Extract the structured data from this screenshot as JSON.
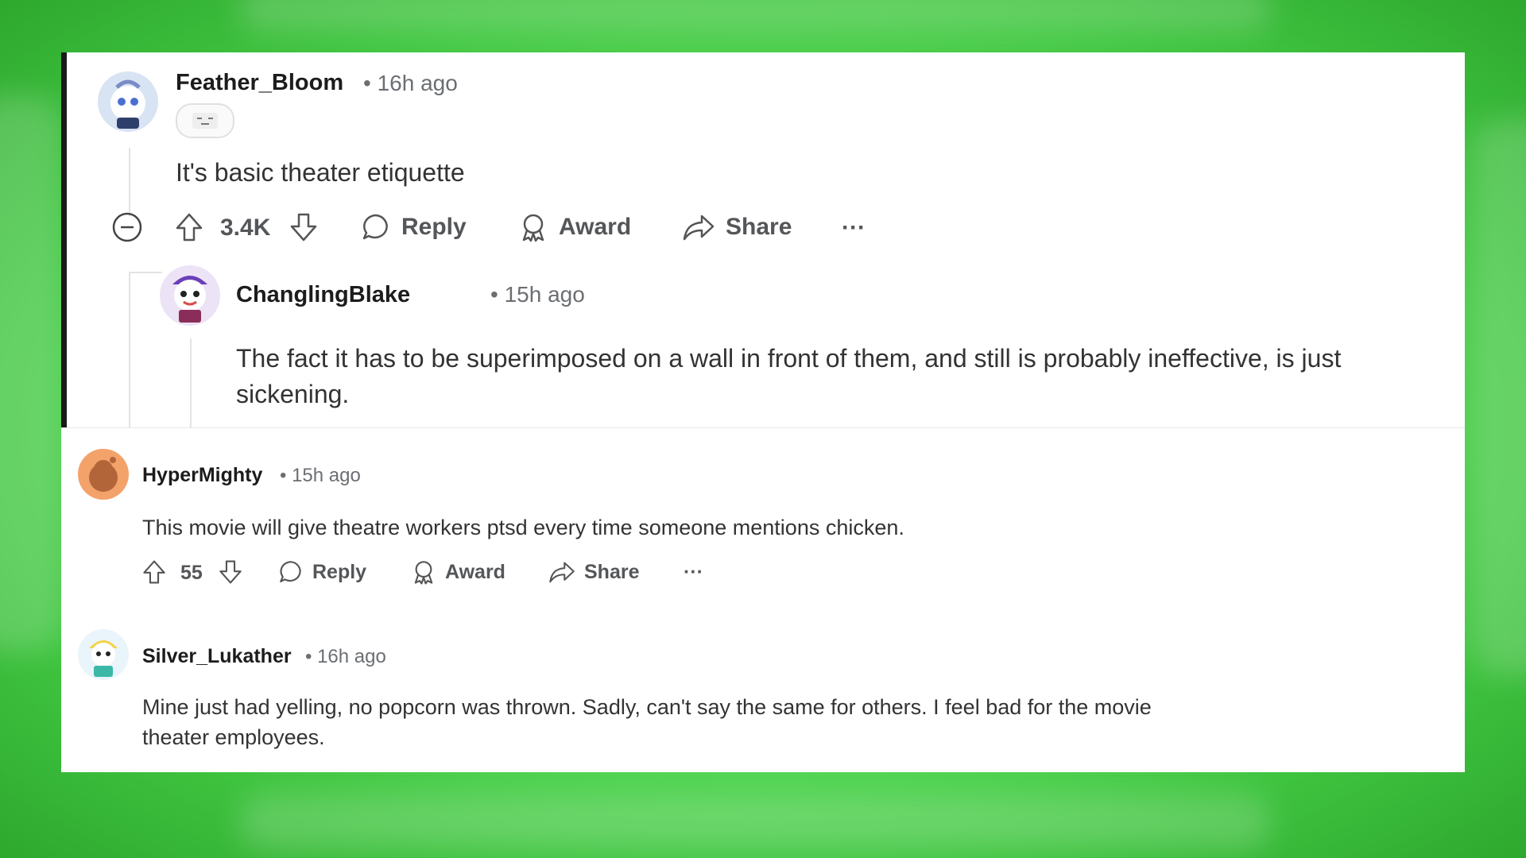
{
  "comments": [
    {
      "username": "Feather_Bloom",
      "time": "• 16h ago",
      "body": "It's basic theater etiquette",
      "score": "3.4K",
      "actions": {
        "reply": "Reply",
        "award": "Award",
        "share": "Share",
        "more": "···"
      },
      "avatar_color": "#c9d9f0"
    },
    {
      "username": "ChanglingBlake",
      "time": "• 15h ago",
      "body": "The fact it has to be superimposed on a wall in front of them, and still is probably ineffective, is just sickening.",
      "avatar_color": "#e9d9f5"
    },
    {
      "username": "HyperMighty",
      "time": "• 15h ago",
      "body": "This movie will give theatre workers ptsd every time someone mentions chicken.",
      "score": "55",
      "actions": {
        "reply": "Reply",
        "award": "Award",
        "share": "Share",
        "more": "···"
      },
      "avatar_color": "#f3a26a"
    },
    {
      "username": "Silver_Lukather",
      "time": "• 16h ago",
      "body": "Mine just had yelling, no popcorn was thrown. Sadly, can't say the same for others. I feel bad for the movie theater employees.",
      "avatar_color": "#e8f4fb"
    }
  ],
  "colors": {
    "background_green": "#6ee86e",
    "focus_bar": "#1a1a1b",
    "text": "#333333",
    "meta": "#6b6e72"
  }
}
